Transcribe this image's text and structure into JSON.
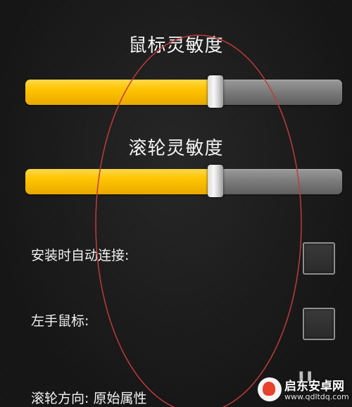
{
  "sliders": {
    "mouse_sensitivity": {
      "title": "鼠标灵敏度",
      "value_fraction": 0.6
    },
    "wheel_sensitivity": {
      "title": "滚轮灵敏度",
      "value_fraction": 0.6
    }
  },
  "settings": {
    "auto_connect": {
      "label": "安装时自动连接:",
      "checked": false
    },
    "left_hand_mouse": {
      "label": "左手鼠标:",
      "checked": false
    },
    "wheel_direction": {
      "label": "滚轮方向: 原始属性"
    }
  },
  "watermark": {
    "title": "启东安卓网",
    "url": "www.qdltdq.com"
  },
  "colors": {
    "slider_fill": "#ffc400",
    "slider_track": "#7d7d7d",
    "annotation_ellipse": "#c23a3a",
    "background": "#1b1b1b"
  }
}
